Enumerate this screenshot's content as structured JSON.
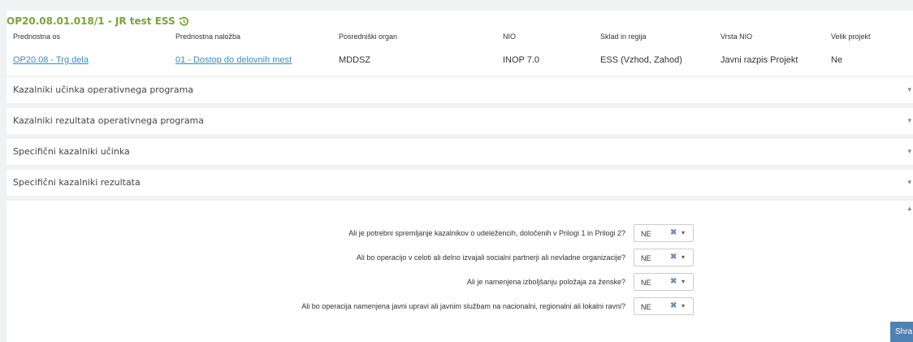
{
  "operation": {
    "title": "OP20.08.01.018/1 - JR test ESS",
    "title_icon": "history-icon"
  },
  "table": {
    "headers": [
      "Prednostna os",
      "Prednostna naložba",
      "Posredniški organ",
      "NIO",
      "Sklad in regija",
      "Vrsta NIO",
      "Velik projekt"
    ],
    "values": [
      "OP20.08 - Trg dela",
      "01 - Dostop do delovnih mest",
      "MDDSZ",
      "INOP 7.0",
      "ESS (Vzhod, Zahod)",
      "Javni razpis Projekt",
      "Ne"
    ]
  },
  "accordions": [
    "Kazalniki učinka operativnega programa",
    "Kazalniki rezultata operativnega programa",
    "Specifični kazalniki učinka",
    "Specifični kazalniki rezultata"
  ],
  "questions": [
    {
      "text": "Ali je potrebni spremljanje kazalnikov o udeležencih, določenih v Prilogi 1 in Prilogi 2?",
      "value": "NE"
    },
    {
      "text": "Ali bo operacijo v celoti ali delno izvajali socialni partnerji ali nevladne organizacije?",
      "value": "NE"
    },
    {
      "text": "Ali je namenjena izboljšanju položaja za ženske?",
      "value": "NE"
    },
    {
      "text": "Ali bo operacija namenjena javni upravi ali javnim službam na nacionalni, regionalni ali lokalni ravni?",
      "value": "NE"
    }
  ],
  "save_label": "Shra",
  "colors": {
    "title_green": "#78a33a",
    "link_blue": "#3a8dc0",
    "button_blue": "#4f81b5",
    "page_bg": "#f1f2f3"
  }
}
